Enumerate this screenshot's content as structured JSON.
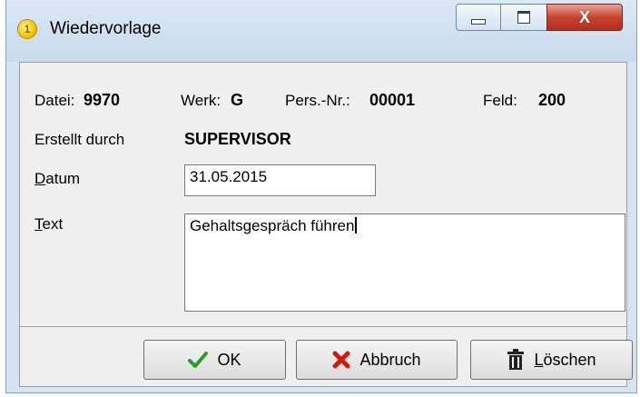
{
  "window": {
    "title": "Wiedervorlage",
    "app_icon_text": "1",
    "close_glyph": "X",
    "colors": {
      "close_button": "#c8432f",
      "title_bar": "#c9dbee",
      "ok_check": "#2f9a2a",
      "cancel_x": "#d11a0a"
    }
  },
  "info": {
    "datei_label": "Datei:",
    "datei_value": "9970",
    "werk_label": "Werk:",
    "werk_value": "G",
    "pers_label": "Pers.-Nr.:",
    "pers_value": "00001",
    "feld_label": "Feld:",
    "feld_value": "200",
    "erstellt_label": "Erstellt durch",
    "erstellt_value": "SUPERVISOR"
  },
  "form": {
    "datum_label_access": "D",
    "datum_label_rest": "atum",
    "datum_value": "31.05.2015",
    "text_label_access": "T",
    "text_label_rest": "ext",
    "text_value": "Gehaltsgespräch führen"
  },
  "buttons": {
    "ok_label": "OK",
    "ok_icon": "checkmark-icon",
    "cancel_label": "Abbruch",
    "cancel_icon": "cross-icon",
    "delete_label_access": "L",
    "delete_label_rest": "öschen",
    "delete_icon": "trash-icon"
  }
}
